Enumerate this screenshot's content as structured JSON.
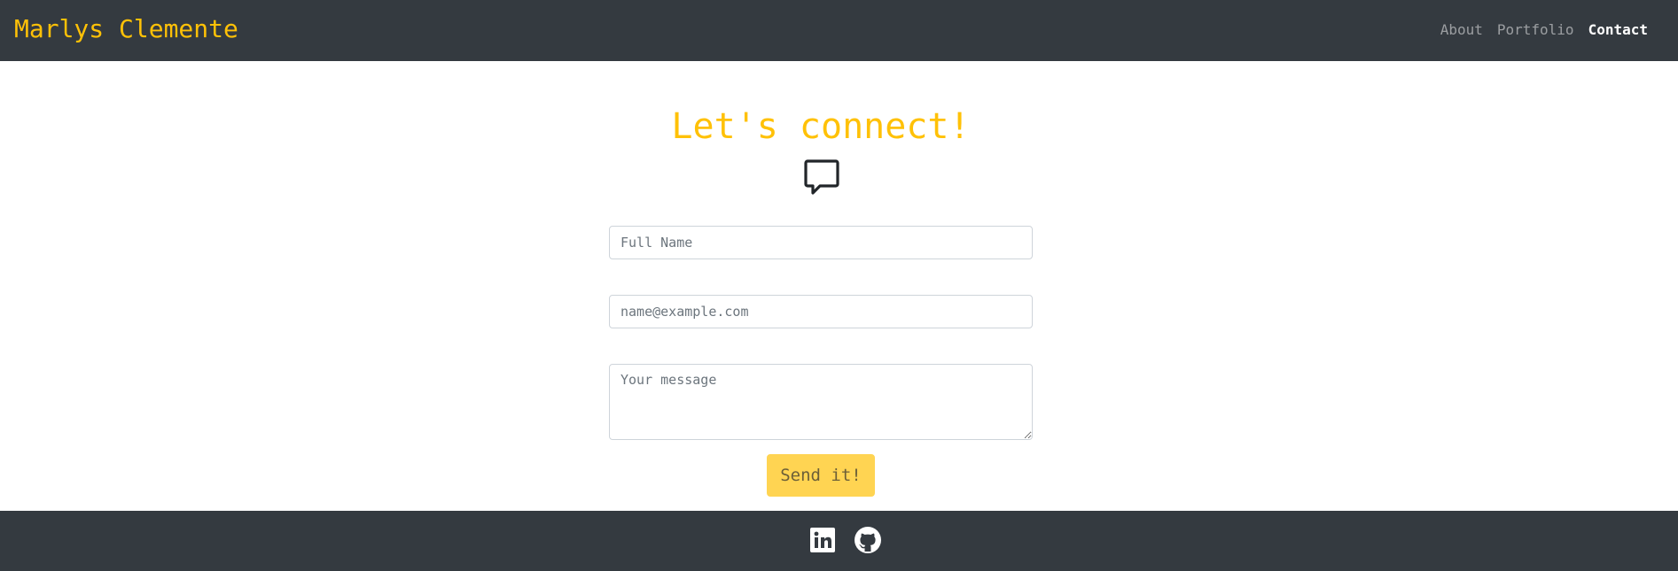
{
  "navbar": {
    "brand": "Marlys Clemente",
    "links": [
      {
        "label": "About",
        "active": false
      },
      {
        "label": "Portfolio",
        "active": false
      },
      {
        "label": "Contact",
        "active": true
      }
    ]
  },
  "contact": {
    "heading": "Let's connect!",
    "icon": "chat-square-icon",
    "fields": {
      "name_placeholder": "Full Name",
      "email_placeholder": "name@example.com",
      "message_placeholder": "Your message"
    },
    "submit_label": "Send it!"
  },
  "footer": {
    "icons": [
      "linkedin-icon",
      "github-icon"
    ]
  },
  "colors": {
    "navbar_bg": "#343a40",
    "accent": "#ffc107",
    "button_bg": "#ffd452",
    "footer_bg": "#343a40"
  }
}
